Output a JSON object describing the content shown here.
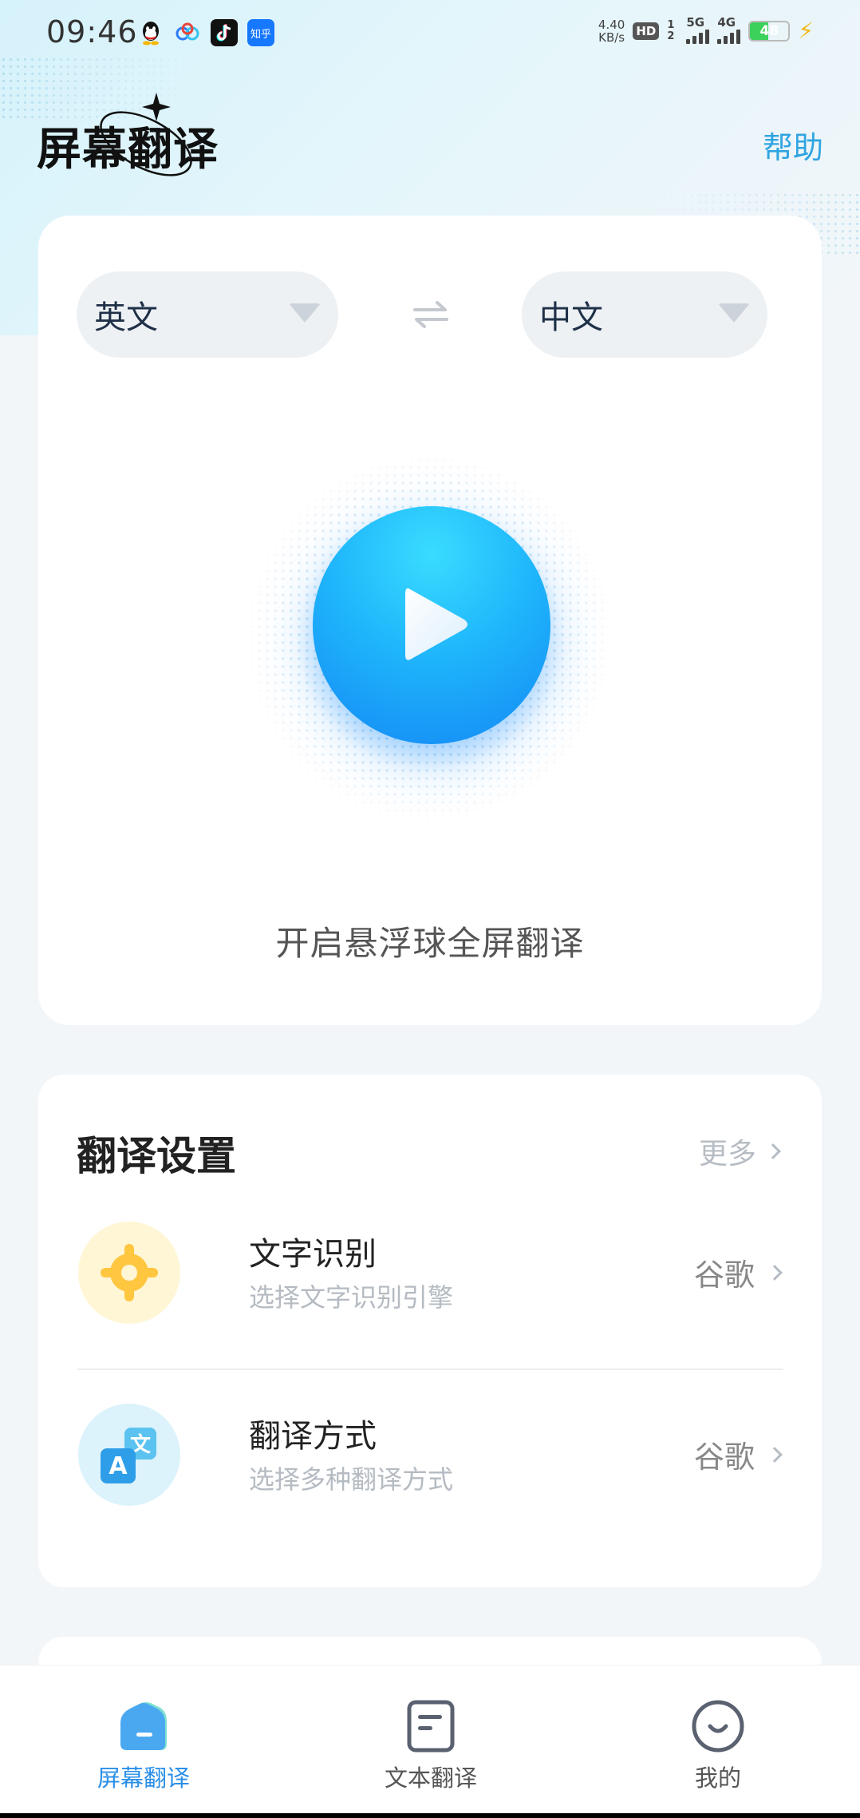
{
  "status_bar": {
    "time": "09:46",
    "apps": [
      "qq-icon",
      "baidu-netdisk-icon",
      "tiktok-icon",
      "zhihu-icon"
    ],
    "zhihu_label": "知乎",
    "net_speed_value": "4.40",
    "net_speed_unit": "KB/s",
    "hd_label": "HD",
    "sim_slots": "1 2",
    "signal_1": "5G",
    "signal_2": "4G",
    "battery": "48",
    "battery_level": 0.48,
    "charging": true
  },
  "header": {
    "title": "屏幕翻译",
    "help": "帮助"
  },
  "main_card": {
    "source_lang": "英文",
    "target_lang": "中文",
    "caption": "开启悬浮球全屏翻译"
  },
  "settings": {
    "title": "翻译设置",
    "more": "更多",
    "rows": [
      {
        "title": "文字识别",
        "subtitle": "选择文字识别引擎",
        "value": "谷歌",
        "icon": "ocr-target-icon"
      },
      {
        "title": "翻译方式",
        "subtitle": "选择多种翻译方式",
        "value": "谷歌",
        "icon": "translate-a-wen-icon"
      }
    ]
  },
  "bottom_nav": {
    "items": [
      {
        "label": "屏幕翻译",
        "icon": "home-icon",
        "active": true
      },
      {
        "label": "文本翻译",
        "icon": "document-icon",
        "active": false
      },
      {
        "label": "我的",
        "icon": "smiley-profile-icon",
        "active": false
      }
    ]
  },
  "colors": {
    "accent": "#2b8fe8",
    "help_link": "#2fa5e0",
    "play_button": "#1fb6fb",
    "battery": "#3bd15a"
  }
}
